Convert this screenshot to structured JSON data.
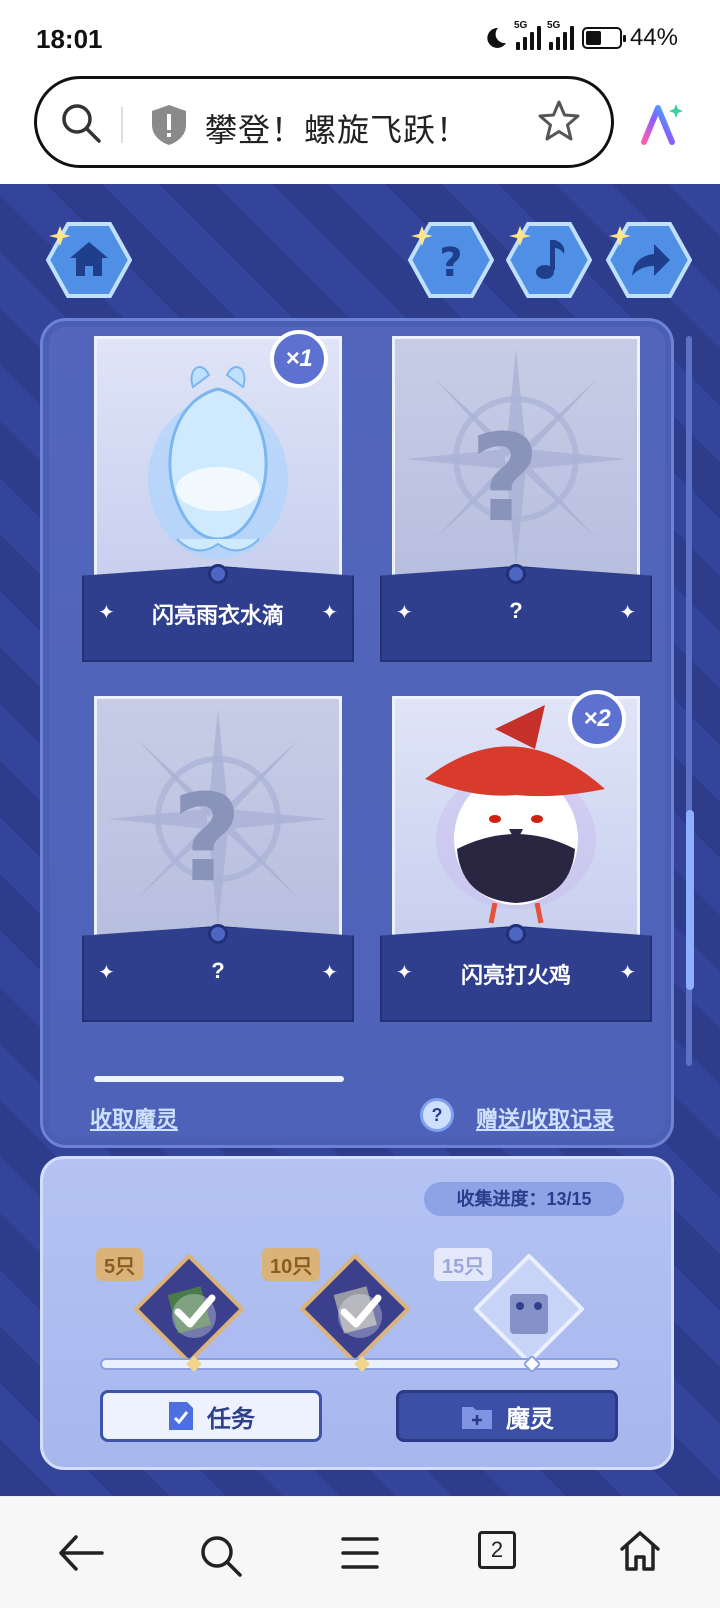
{
  "status_bar": {
    "time": "18:01",
    "network_1": "5G",
    "network_2": "5G",
    "battery": "44%"
  },
  "browser": {
    "url_title": "攀登！螺旋飞跃！"
  },
  "game": {
    "cards": [
      {
        "name": "闪亮雨衣水滴",
        "count": "×1",
        "known": true
      },
      {
        "name": "?",
        "known": false
      },
      {
        "name": "?",
        "known": false
      },
      {
        "name": "闪亮打火鸡",
        "count": "×2",
        "known": true
      }
    ],
    "collect_link": "收取魔灵",
    "record_link": "赠送/收取记录",
    "help_glyph": "?",
    "progress_label": "收集进度：13/15",
    "collection_progress": {
      "collected": 13,
      "total": 15
    },
    "milestones": [
      {
        "label": "5只",
        "done": true
      },
      {
        "label": "10只",
        "done": true
      },
      {
        "label": "15只",
        "done": false
      }
    ],
    "task_button": "任务",
    "spirit_button": "魔灵"
  },
  "nav": {
    "tabs_count": "2"
  }
}
